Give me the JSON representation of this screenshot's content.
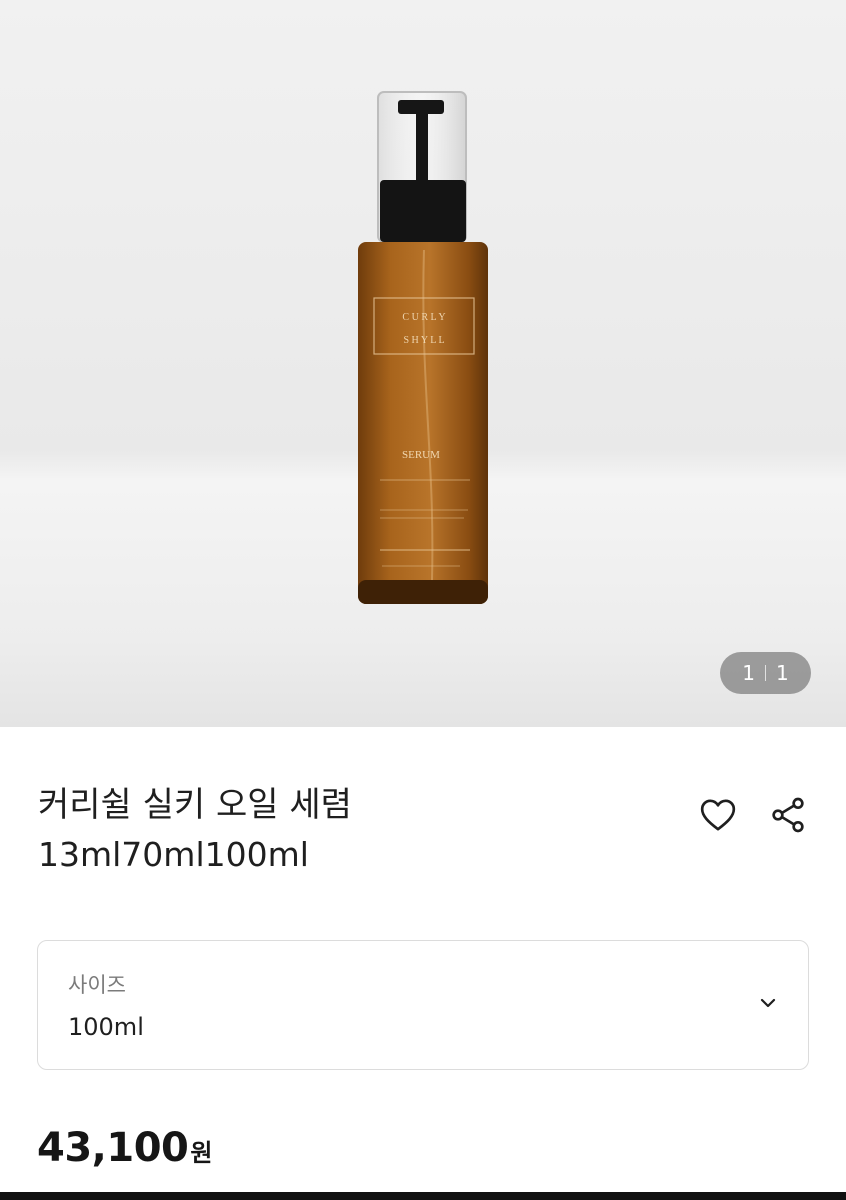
{
  "hero": {
    "bottle_brand_lines": [
      "C U R L Y",
      "S H Y L L"
    ],
    "bottle_label_main": "SERUM",
    "page_current": "1",
    "page_total": "1"
  },
  "product": {
    "title": "커리쉴 실키 오일 세렴",
    "subtitle": "13ml70ml100ml"
  },
  "actions": {
    "like_icon": "heart-icon",
    "share_icon": "share-icon"
  },
  "option": {
    "label": "사이즈",
    "value": "100ml",
    "chevron_icon": "chevron-down-icon"
  },
  "price": {
    "amount": "43,100",
    "unit": "원"
  },
  "colors": {
    "bottle_amber": "#9a5a16",
    "cap_black": "#151515",
    "text_primary": "#1f1f1f",
    "text_secondary": "#7b7b7b",
    "border": "#dcdcdc"
  }
}
